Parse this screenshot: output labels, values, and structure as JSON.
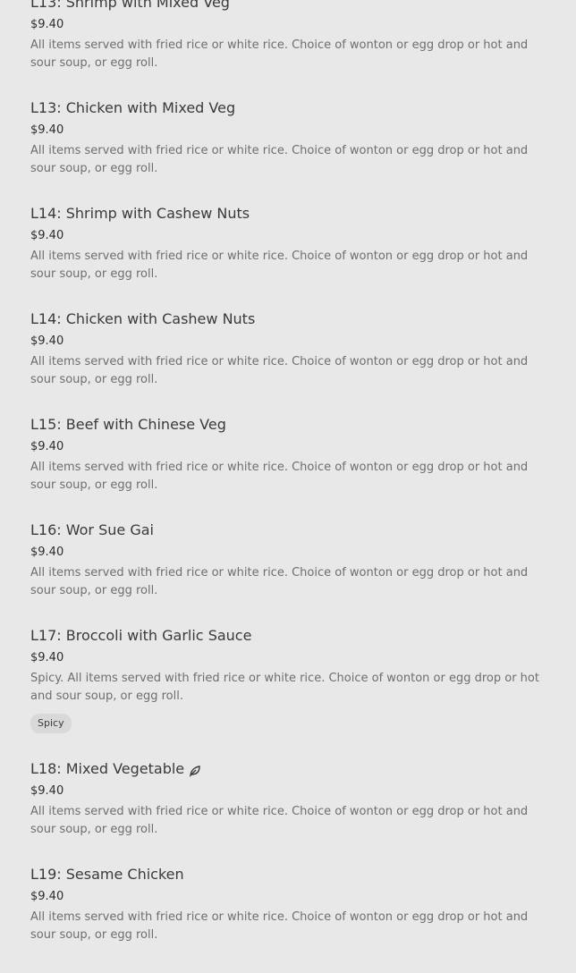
{
  "items": [
    {
      "name": "L13: Shrimp with Mixed Veg",
      "price": "$9.40",
      "description": "All items served with fried rice or white rice. Choice of wonton or egg drop or hot and sour soup, or egg roll."
    },
    {
      "name": "L13: Chicken with Mixed Veg",
      "price": "$9.40",
      "description": "All items served with fried rice or white rice. Choice of wonton or egg drop or hot and sour soup, or egg roll."
    },
    {
      "name": "L14: Shrimp with Cashew Nuts",
      "price": "$9.40",
      "description": "All items served with fried rice or white rice. Choice of wonton or egg drop or hot and sour soup, or egg roll."
    },
    {
      "name": "L14: Chicken with Cashew Nuts",
      "price": "$9.40",
      "description": "All items served with fried rice or white rice. Choice of wonton or egg drop or hot and sour soup, or egg roll."
    },
    {
      "name": "L15: Beef with Chinese Veg",
      "price": "$9.40",
      "description": "All items served with fried rice or white rice. Choice of wonton or egg drop or hot and sour soup, or egg roll."
    },
    {
      "name": "L16: Wor Sue Gai",
      "price": "$9.40",
      "description": "All items served with fried rice or white rice. Choice of wonton or egg drop or hot and sour soup, or egg roll."
    },
    {
      "name": "L17: Broccoli with Garlic Sauce",
      "price": "$9.40",
      "description": "Spicy. All items served with fried rice or white rice. Choice of wonton or egg drop or hot and sour soup, or egg roll.",
      "tag": "Spicy"
    },
    {
      "name": "L18: Mixed Vegetable",
      "price": "$9.40",
      "description": "All items served with fried rice or white rice. Choice of wonton or egg drop or hot and sour soup, or egg roll.",
      "icon": "leaf-icon"
    },
    {
      "name": "L19: Sesame Chicken",
      "price": "$9.40",
      "description": "All items served with fried rice or white rice. Choice of wonton or egg drop or hot and sour soup, or egg roll."
    }
  ]
}
